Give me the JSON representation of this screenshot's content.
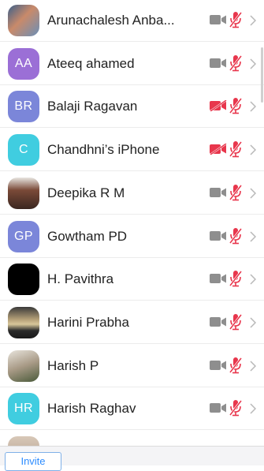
{
  "participants": [
    {
      "name": "Arunachalesh Anba...",
      "initials": "",
      "avatar_color": "#6a8fb8",
      "video_off": false
    },
    {
      "name": "Ateeq ahamed",
      "initials": "AA",
      "avatar_color": "#9b6fd6",
      "video_off": false
    },
    {
      "name": "Balaji Ragavan",
      "initials": "BR",
      "avatar_color": "#7b86d9",
      "video_off": true
    },
    {
      "name": "Chandhni’s iPhone",
      "initials": "C",
      "avatar_color": "#40cde0",
      "video_off": true
    },
    {
      "name": "Deepika R M",
      "initials": "",
      "avatar_color": "#5a3a2f",
      "video_off": false
    },
    {
      "name": "Gowtham PD",
      "initials": "GP",
      "avatar_color": "#7b86d9",
      "video_off": false
    },
    {
      "name": "H. Pavithra",
      "initials": "",
      "avatar_color": "#000000",
      "video_off": false
    },
    {
      "name": "Harini Prabha",
      "initials": "",
      "avatar_color": "#8c7a5a",
      "video_off": false
    },
    {
      "name": "Harish P",
      "initials": "",
      "avatar_color": "#c8c2b8",
      "video_off": false
    },
    {
      "name": "Harish Raghav",
      "initials": "HR",
      "avatar_color": "#40cde0",
      "video_off": false
    },
    {
      "name": "",
      "initials": "",
      "avatar_color": "#c9b7a6",
      "video_off": false
    }
  ],
  "icons": {
    "camera": "camera-icon",
    "mic_muted": "mic-muted-icon",
    "chevron": "chevron-right-icon"
  },
  "colors": {
    "muted_red": "#e8364c",
    "camera_gray": "#8e8e8e",
    "accent": "#2d8cff"
  },
  "bottom_bar": {
    "invite_label": "Invite"
  }
}
